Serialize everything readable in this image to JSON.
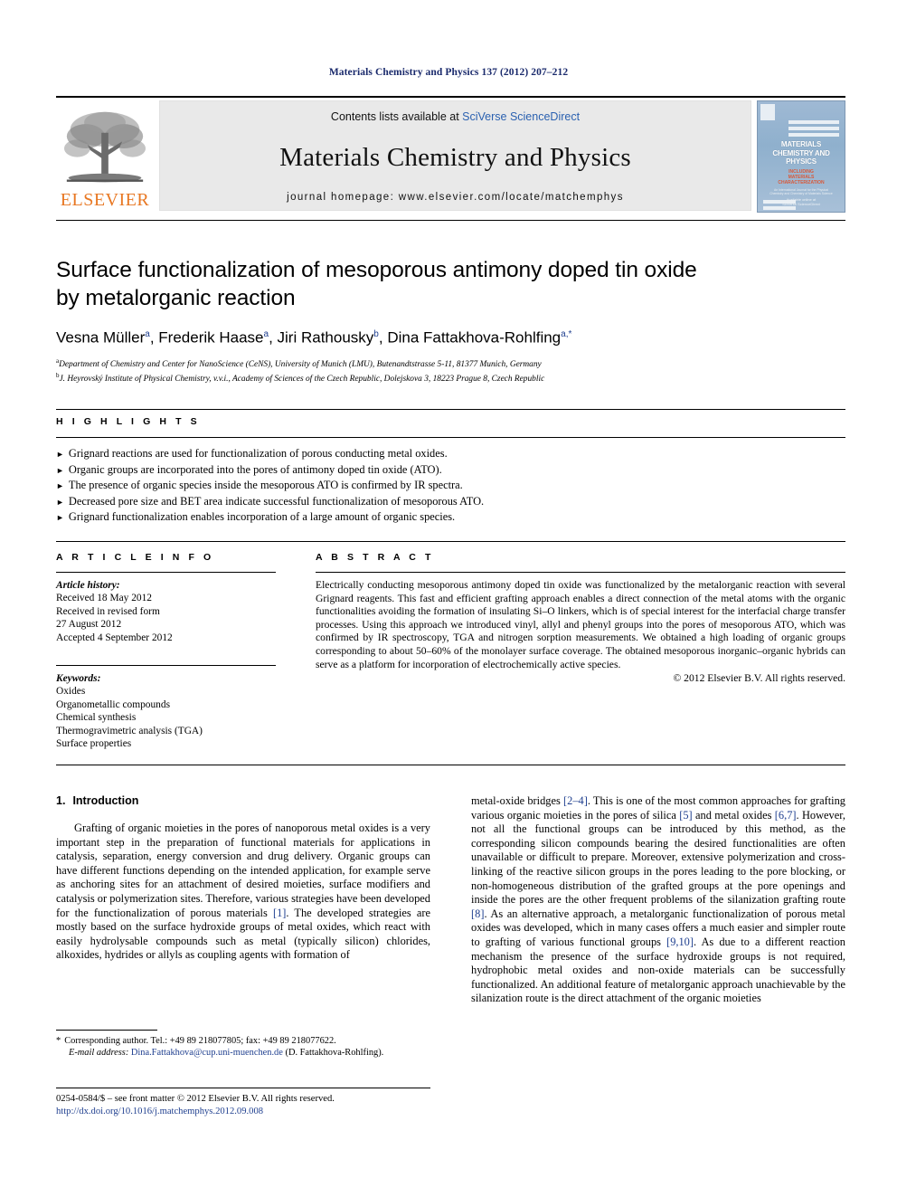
{
  "running_head": "Materials Chemistry and Physics 137 (2012) 207–212",
  "masthead": {
    "contents_prefix": "Contents lists available at ",
    "contents_link": "SciVerse ScienceDirect",
    "journal_title": "Materials Chemistry and Physics",
    "homepage": "journal homepage: www.elsevier.com/locate/matchemphys",
    "publisher_name": "ELSEVIER",
    "cover": {
      "title_line1": "MATERIALS",
      "title_line2": "CHEMISTRY AND",
      "title_line3": "PHYSICS",
      "subtitle_line1": "INCLUDING",
      "subtitle_line2": "MATERIALS",
      "subtitle_line3": "CHARACTERIZATION",
      "fine_line1": "An International Journal for the Physical",
      "fine_line2": "Chemistry and Chemistry of Materials Science",
      "footer_line1": "Available online at",
      "footer_line2": "SciVerse ScienceDirect"
    }
  },
  "article": {
    "title_line1": "Surface functionalization of mesoporous antimony doped tin oxide",
    "title_line2": "by metalorganic reaction",
    "authors": [
      {
        "name": "Vesna Müller",
        "sup": "a",
        "sep": ", "
      },
      {
        "name": "Frederik Haase",
        "sup": "a",
        "sep": ", "
      },
      {
        "name": "Jiri Rathousky",
        "sup": "b",
        "sep": ", "
      },
      {
        "name": "Dina Fattakhova-Rohlfing",
        "sup": "a,*",
        "sep": ""
      }
    ],
    "affiliations": [
      {
        "sup": "a",
        "text": "Department of Chemistry and Center for NanoScience (CeNS), University of Munich (LMU), Butenandtstrasse 5-11, 81377 Munich, Germany"
      },
      {
        "sup": "b",
        "text": "J. Heyrovský Institute of Physical Chemistry, v.v.i., Academy of Sciences of the Czech Republic, Dolejskova 3, 18223 Prague 8, Czech Republic"
      }
    ]
  },
  "highlights": {
    "heading": "H I G H L I G H T S",
    "arrow": "►",
    "items": [
      "Grignard reactions are used for functionalization of porous conducting metal oxides.",
      "Organic groups are incorporated into the pores of antimony doped tin oxide (ATO).",
      "The presence of organic species inside the mesoporous ATO is confirmed by IR spectra.",
      "Decreased pore size and BET area indicate successful functionalization of mesoporous ATO.",
      "Grignard functionalization enables incorporation of a large amount of organic species."
    ]
  },
  "article_info": {
    "heading": "A R T I C L E   I N F O",
    "history_label": "Article history:",
    "history_lines": [
      "Received 18 May 2012",
      "Received in revised form",
      "27 August 2012",
      "Accepted 4 September 2012"
    ],
    "keywords_label": "Keywords:",
    "keywords": [
      "Oxides",
      "Organometallic compounds",
      "Chemical synthesis",
      "Thermogravimetric analysis (TGA)",
      "Surface properties"
    ]
  },
  "abstract": {
    "heading": "A B S T R A C T",
    "text": "Electrically conducting mesoporous antimony doped tin oxide was functionalized by the metalorganic reaction with several Grignard reagents. This fast and efficient grafting approach enables a direct connection of the metal atoms with the organic functionalities avoiding the formation of insulating Si–O linkers, which is of special interest for the interfacial charge transfer processes. Using this approach we introduced vinyl, allyl and phenyl groups into the pores of mesoporous ATO, which was confirmed by IR spectroscopy, TGA and nitrogen sorption measurements. We obtained a high loading of organic groups corresponding to about 50–60% of the monolayer surface coverage. The obtained mesoporous inorganic–organic hybrids can serve as a platform for incorporation of electrochemically active species.",
    "copyright": "© 2012 Elsevier B.V. All rights reserved."
  },
  "body": {
    "section_number": "1.",
    "section_title": "Introduction",
    "left_paragraph_parts": [
      {
        "t": "Grafting of organic moieties in the pores of nanoporous metal oxides is a very important step in the preparation of functional materials for applications in catalysis, separation, energy conversion and drug delivery. Organic groups can have different functions depending on the intended application, for example serve as anchoring sites for an attachment of desired moieties, surface modifiers and catalysis or polymerization sites. Therefore, various strategies have been developed for the functionalization of porous materials "
      },
      {
        "t": "[1]",
        "ref": true
      },
      {
        "t": ". The developed strategies are mostly based on the surface hydroxide groups of metal oxides, which react with easily hydrolysable compounds such as metal (typically silicon) chlorides, alkoxides, hydrides or allyls as coupling agents with formation of"
      }
    ],
    "right_paragraph_parts": [
      {
        "t": "metal-oxide bridges "
      },
      {
        "t": "[2–4]",
        "ref": true
      },
      {
        "t": ". This is one of the most common approaches for grafting various organic moieties in the pores of silica "
      },
      {
        "t": "[5]",
        "ref": true
      },
      {
        "t": " and metal oxides "
      },
      {
        "t": "[6,7]",
        "ref": true
      },
      {
        "t": ". However, not all the functional groups can be introduced by this method, as the corresponding silicon compounds bearing the desired functionalities are often unavailable or difficult to prepare. Moreover, extensive polymerization and cross-linking of the reactive silicon groups in the pores leading to the pore blocking, or non-homogeneous distribution of the grafted groups at the pore openings and inside the pores are the other frequent problems of the silanization grafting route "
      },
      {
        "t": "[8]",
        "ref": true
      },
      {
        "t": ". As an alternative approach, a metalorganic functionalization of porous metal oxides was developed, which in many cases offers a much easier and simpler route to grafting of various functional groups "
      },
      {
        "t": "[9,10]",
        "ref": true
      },
      {
        "t": ". As due to a different reaction mechanism the presence of the surface hydroxide groups is not required, hydrophobic metal oxides and non-oxide materials can be successfully functionalized. An additional feature of metalorganic approach unachievable by the silanization route is the direct attachment of the organic moieties"
      }
    ]
  },
  "footnote": {
    "star": "*",
    "corresponding": "Corresponding author. Tel.: +49 89 218077805; fax: +49 89 218077622.",
    "email_label": "E-mail address:",
    "email": "Dina.Fattakhova@cup.uni-muenchen.de",
    "email_owner": "(D. Fattakhova-Rohlfing)."
  },
  "bottom": {
    "issn_line": "0254-0584/$ – see front matter © 2012 Elsevier B.V. All rights reserved.",
    "doi": "http://dx.doi.org/10.1016/j.matchemphys.2012.09.008"
  }
}
